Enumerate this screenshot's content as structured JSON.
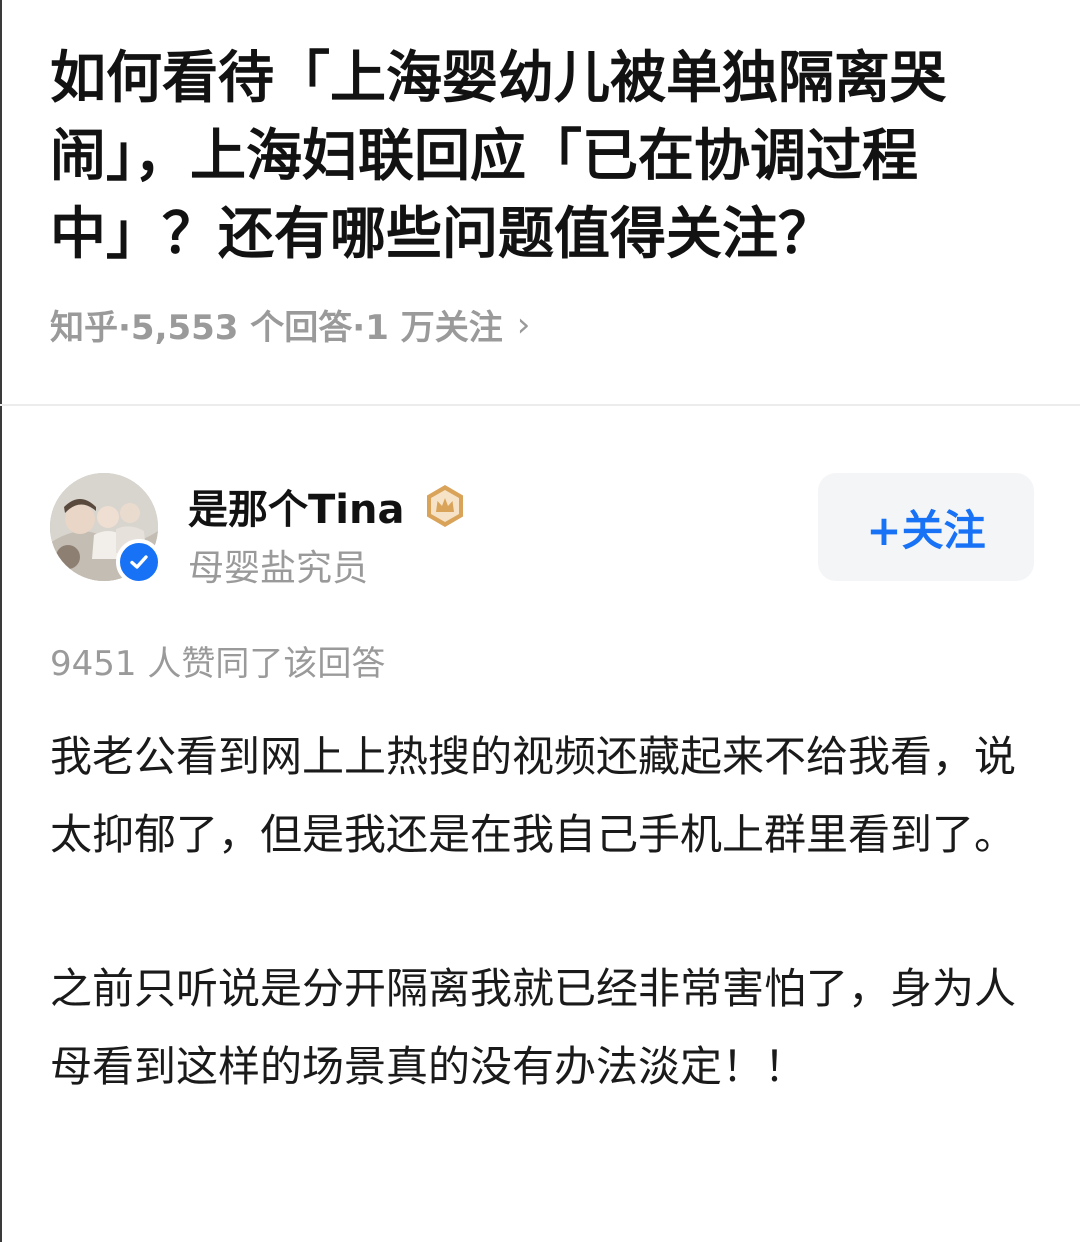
{
  "question": {
    "title": "如何看待「上海婴幼儿被单独隔离哭闹」，上海妇联回应「已在协调过程中」？还有哪些问题值得关注？",
    "meta": "知乎·5,553 个回答·1 万关注",
    "chevron": "›"
  },
  "author": {
    "name": "是那个Tina",
    "bio": "母婴盐究员",
    "follow_label": "+关注",
    "avatar_icon": "avatar-photo",
    "badge_icon": "verified-check-icon",
    "level_icon": "crown-badge-icon"
  },
  "answer": {
    "votes": "9451 人赞同了该回答",
    "paragraphs": [
      "我老公看到网上上热搜的视频还藏起来不给我看，说太抑郁了，但是我还是在我自己手机上群里看到了。",
      "之前只听说是分开隔离我就已经非常害怕了，身为人母看到这样的场景真的没有办法淡定！！"
    ]
  },
  "colors": {
    "accent": "#1772f6",
    "meta_gray": "#9a9a9a",
    "title": "#121212",
    "crown_gold": "#d9a35a"
  }
}
